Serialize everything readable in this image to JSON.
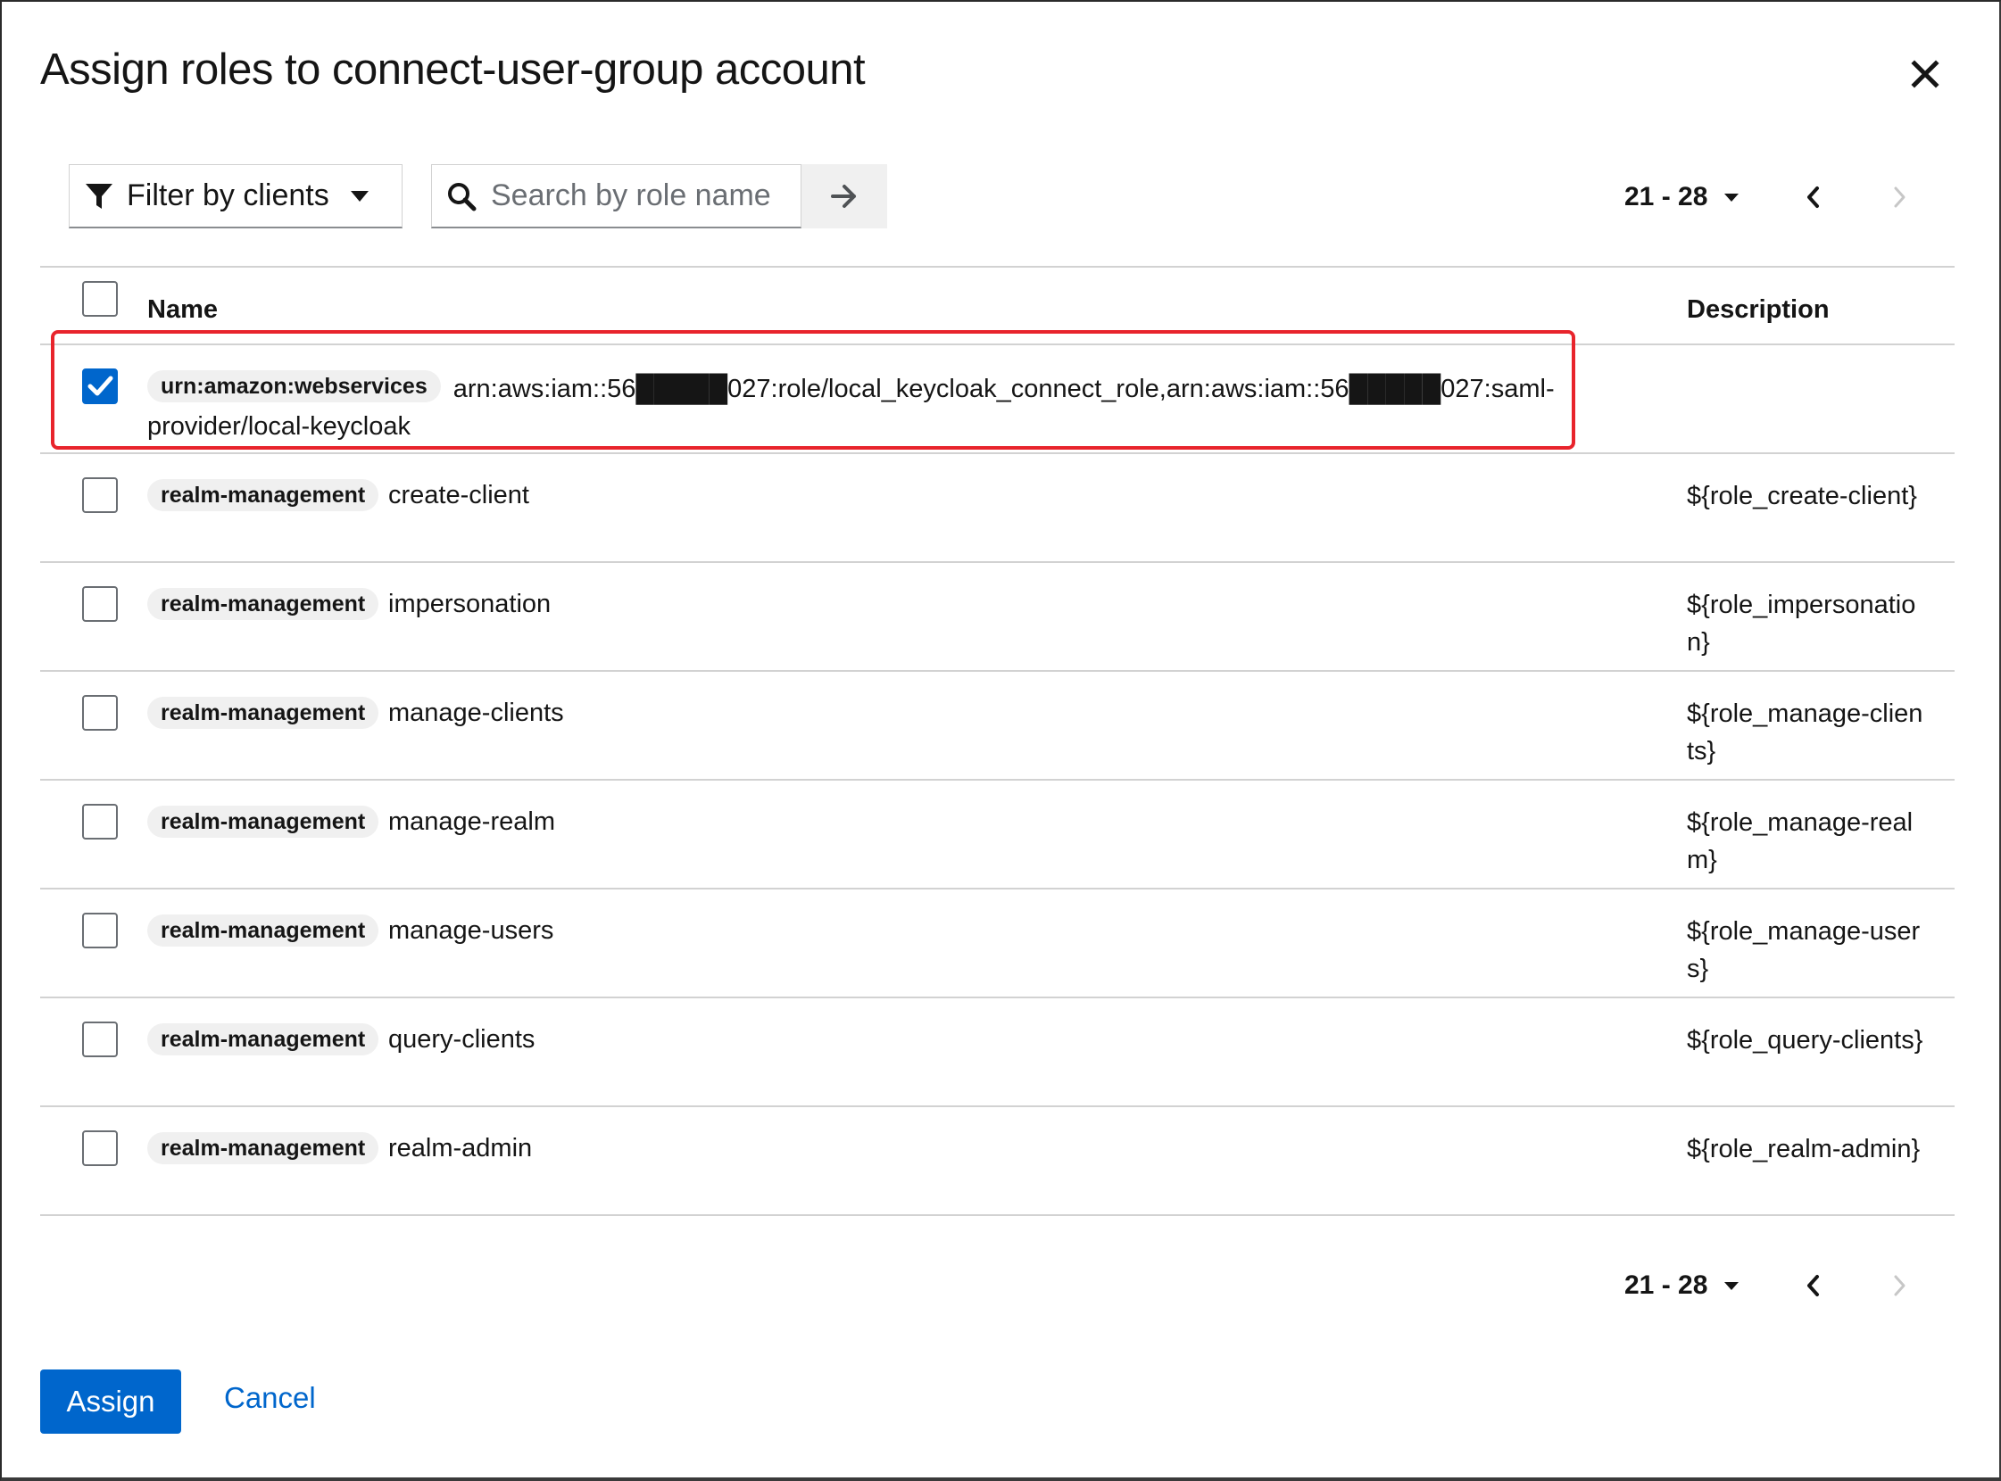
{
  "dialog": {
    "title": "Assign roles to connect-user-group account"
  },
  "toolbar": {
    "filter_label": "Filter by clients",
    "search_placeholder": "Search by role name"
  },
  "pagination": {
    "range": "21 - 28"
  },
  "table": {
    "columns": {
      "name": "Name",
      "description": "Description"
    },
    "rows": [
      {
        "client": "urn:amazon:webservices",
        "name": "arn:aws:iam::56█████027:role/local_keycloak_connect_role,arn:aws:iam::56█████027:saml-provider/local-keycloak",
        "description": "",
        "checked": true
      },
      {
        "client": "realm-management",
        "name": "create-client",
        "description": "${role_create-client}",
        "checked": false
      },
      {
        "client": "realm-management",
        "name": "impersonation",
        "description": "${role_impersonation}",
        "checked": false
      },
      {
        "client": "realm-management",
        "name": "manage-clients",
        "description": "${role_manage-clients}",
        "checked": false
      },
      {
        "client": "realm-management",
        "name": "manage-realm",
        "description": "${role_manage-realm}",
        "checked": false
      },
      {
        "client": "realm-management",
        "name": "manage-users",
        "description": "${role_manage-users}",
        "checked": false
      },
      {
        "client": "realm-management",
        "name": "query-clients",
        "description": "${role_query-clients}",
        "checked": false
      },
      {
        "client": "realm-management",
        "name": "realm-admin",
        "description": "${role_realm-admin}",
        "checked": false
      }
    ]
  },
  "footer": {
    "assign_label": "Assign",
    "cancel_label": "Cancel"
  },
  "colors": {
    "primary": "#0066cc",
    "highlight": "#e8242c",
    "border": "#d2d2d2"
  }
}
